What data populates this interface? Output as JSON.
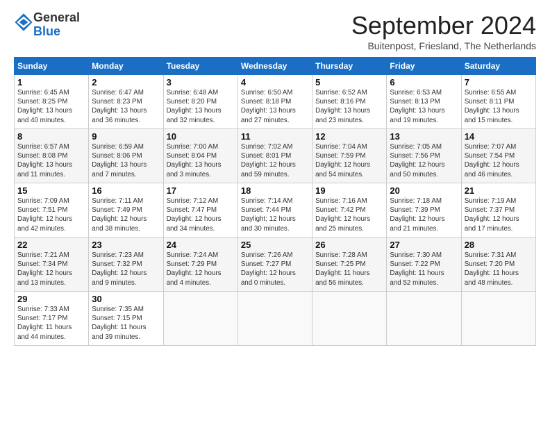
{
  "header": {
    "logo_line1": "General",
    "logo_line2": "Blue",
    "month": "September 2024",
    "location": "Buitenpost, Friesland, The Netherlands"
  },
  "days_of_week": [
    "Sunday",
    "Monday",
    "Tuesday",
    "Wednesday",
    "Thursday",
    "Friday",
    "Saturday"
  ],
  "weeks": [
    [
      {
        "day": "1",
        "info": "Sunrise: 6:45 AM\nSunset: 8:25 PM\nDaylight: 13 hours\nand 40 minutes."
      },
      {
        "day": "2",
        "info": "Sunrise: 6:47 AM\nSunset: 8:23 PM\nDaylight: 13 hours\nand 36 minutes."
      },
      {
        "day": "3",
        "info": "Sunrise: 6:48 AM\nSunset: 8:20 PM\nDaylight: 13 hours\nand 32 minutes."
      },
      {
        "day": "4",
        "info": "Sunrise: 6:50 AM\nSunset: 8:18 PM\nDaylight: 13 hours\nand 27 minutes."
      },
      {
        "day": "5",
        "info": "Sunrise: 6:52 AM\nSunset: 8:16 PM\nDaylight: 13 hours\nand 23 minutes."
      },
      {
        "day": "6",
        "info": "Sunrise: 6:53 AM\nSunset: 8:13 PM\nDaylight: 13 hours\nand 19 minutes."
      },
      {
        "day": "7",
        "info": "Sunrise: 6:55 AM\nSunset: 8:11 PM\nDaylight: 13 hours\nand 15 minutes."
      }
    ],
    [
      {
        "day": "8",
        "info": "Sunrise: 6:57 AM\nSunset: 8:08 PM\nDaylight: 13 hours\nand 11 minutes."
      },
      {
        "day": "9",
        "info": "Sunrise: 6:59 AM\nSunset: 8:06 PM\nDaylight: 13 hours\nand 7 minutes."
      },
      {
        "day": "10",
        "info": "Sunrise: 7:00 AM\nSunset: 8:04 PM\nDaylight: 13 hours\nand 3 minutes."
      },
      {
        "day": "11",
        "info": "Sunrise: 7:02 AM\nSunset: 8:01 PM\nDaylight: 12 hours\nand 59 minutes."
      },
      {
        "day": "12",
        "info": "Sunrise: 7:04 AM\nSunset: 7:59 PM\nDaylight: 12 hours\nand 54 minutes."
      },
      {
        "day": "13",
        "info": "Sunrise: 7:05 AM\nSunset: 7:56 PM\nDaylight: 12 hours\nand 50 minutes."
      },
      {
        "day": "14",
        "info": "Sunrise: 7:07 AM\nSunset: 7:54 PM\nDaylight: 12 hours\nand 46 minutes."
      }
    ],
    [
      {
        "day": "15",
        "info": "Sunrise: 7:09 AM\nSunset: 7:51 PM\nDaylight: 12 hours\nand 42 minutes."
      },
      {
        "day": "16",
        "info": "Sunrise: 7:11 AM\nSunset: 7:49 PM\nDaylight: 12 hours\nand 38 minutes."
      },
      {
        "day": "17",
        "info": "Sunrise: 7:12 AM\nSunset: 7:47 PM\nDaylight: 12 hours\nand 34 minutes."
      },
      {
        "day": "18",
        "info": "Sunrise: 7:14 AM\nSunset: 7:44 PM\nDaylight: 12 hours\nand 30 minutes."
      },
      {
        "day": "19",
        "info": "Sunrise: 7:16 AM\nSunset: 7:42 PM\nDaylight: 12 hours\nand 25 minutes."
      },
      {
        "day": "20",
        "info": "Sunrise: 7:18 AM\nSunset: 7:39 PM\nDaylight: 12 hours\nand 21 minutes."
      },
      {
        "day": "21",
        "info": "Sunrise: 7:19 AM\nSunset: 7:37 PM\nDaylight: 12 hours\nand 17 minutes."
      }
    ],
    [
      {
        "day": "22",
        "info": "Sunrise: 7:21 AM\nSunset: 7:34 PM\nDaylight: 12 hours\nand 13 minutes."
      },
      {
        "day": "23",
        "info": "Sunrise: 7:23 AM\nSunset: 7:32 PM\nDaylight: 12 hours\nand 9 minutes."
      },
      {
        "day": "24",
        "info": "Sunrise: 7:24 AM\nSunset: 7:29 PM\nDaylight: 12 hours\nand 4 minutes."
      },
      {
        "day": "25",
        "info": "Sunrise: 7:26 AM\nSunset: 7:27 PM\nDaylight: 12 hours\nand 0 minutes."
      },
      {
        "day": "26",
        "info": "Sunrise: 7:28 AM\nSunset: 7:25 PM\nDaylight: 11 hours\nand 56 minutes."
      },
      {
        "day": "27",
        "info": "Sunrise: 7:30 AM\nSunset: 7:22 PM\nDaylight: 11 hours\nand 52 minutes."
      },
      {
        "day": "28",
        "info": "Sunrise: 7:31 AM\nSunset: 7:20 PM\nDaylight: 11 hours\nand 48 minutes."
      }
    ],
    [
      {
        "day": "29",
        "info": "Sunrise: 7:33 AM\nSunset: 7:17 PM\nDaylight: 11 hours\nand 44 minutes."
      },
      {
        "day": "30",
        "info": "Sunrise: 7:35 AM\nSunset: 7:15 PM\nDaylight: 11 hours\nand 39 minutes."
      },
      {
        "day": "",
        "info": ""
      },
      {
        "day": "",
        "info": ""
      },
      {
        "day": "",
        "info": ""
      },
      {
        "day": "",
        "info": ""
      },
      {
        "day": "",
        "info": ""
      }
    ]
  ]
}
